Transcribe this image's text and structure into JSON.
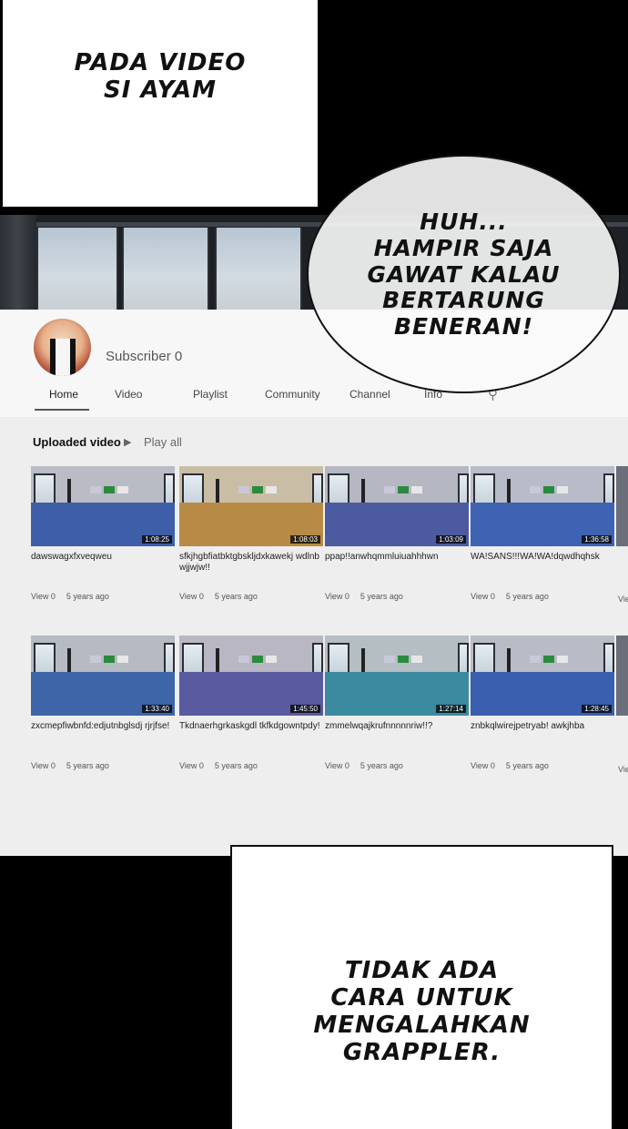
{
  "captions": {
    "top": "PADA VIDEO\nSI AYAM",
    "bubble": "HUH...\nHAMPIR SAJA\nGAWAT KALAU\nBERTARUNG\nBENERAN!",
    "bottom": "TIDAK ADA\nCARA UNTUK\nMENGALAHKAN\nGRAPPLER."
  },
  "channel": {
    "subscriber_label": "Subscriber 0",
    "tabs": [
      "Home",
      "Video",
      "Playlist",
      "Community",
      "Channel",
      "Info"
    ],
    "section_title": "Uploaded video",
    "play_all": "Play all"
  },
  "videos": [
    {
      "title": "dawswagxfxveqweu",
      "duration": "1:08:25",
      "views": "View 0",
      "age": "5 years ago",
      "floor": "#3e5fa8",
      "wall": "#b9bcc4"
    },
    {
      "title": "sfkjhgbfiatbktgbskljdxkawekj wdlnbwjjwjw!!",
      "duration": "1:08:03",
      "views": "View 0",
      "age": "5 years ago",
      "floor": "#b78b45",
      "wall": "#c9bda6"
    },
    {
      "title": "ppap!!anwhqmmluiuahhhwn",
      "duration": "1:03:09",
      "views": "View 0",
      "age": "5 years ago",
      "floor": "#4c5ba0",
      "wall": "#b5b7c3"
    },
    {
      "title": "WA!SANS!!!WA!WA!dqwdhqhsk",
      "duration": "1:36:58",
      "views": "View 0",
      "age": "5 years ago",
      "floor": "#3f63b2",
      "wall": "#b8bcc8"
    },
    {
      "title": "zxcmepfiwbnfd:edjutnbglsdj rjrjfse!",
      "duration": "1:33:40",
      "views": "View 0",
      "age": "5 years ago",
      "floor": "#3d65a7",
      "wall": "#b6bac2"
    },
    {
      "title": "Tkdnaerhgrkaskgdl tkfkdgowntpdy!",
      "duration": "1:45:50",
      "views": "View 0",
      "age": "5 years ago",
      "floor": "#5a5aa0",
      "wall": "#b9b7c4"
    },
    {
      "title": "zmmelwqajkrufnnnnnriw!!?",
      "duration": "1:27:14",
      "views": "View 0",
      "age": "5 years ago",
      "floor": "#3b8aa0",
      "wall": "#b4bec3"
    },
    {
      "title": "znbkqlwirejpetryab! awkjhba",
      "duration": "1:28:45",
      "views": "View 0",
      "age": "5 years ago",
      "floor": "#3a5fae",
      "wall": "#b8bcc7"
    }
  ],
  "partial_column_meta": "Vie",
  "flag_colors": [
    "#c8c8d8",
    "#2b8a3e",
    "#e7e7e7"
  ]
}
